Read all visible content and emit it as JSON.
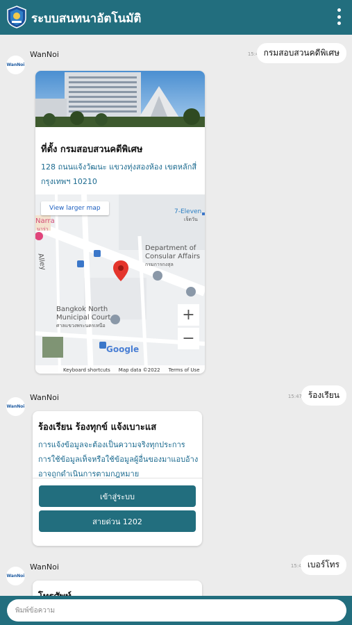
{
  "header": {
    "title": "ระบบสนทนาอัตโนมัติ"
  },
  "messages": [
    {
      "user_text": "กรมสอบสวนคดีพิเศษ",
      "time": "15:47"
    },
    {
      "user_text": "ร้องเรียน",
      "time": "15:47"
    },
    {
      "user_text": "เบอร์โทร",
      "time": "15:48"
    }
  ],
  "bot": {
    "name": "WanNoi",
    "avatar_text": "WanNoi"
  },
  "location_card": {
    "title": "ที่ตั้ง กรมสอบสวนคดีพิเศษ",
    "address": "128 ถนนแจ้งวัฒนะ แขวงทุ่งสองห้อง เขตหลักสี่ กรุงเทพฯ 10210",
    "map": {
      "view_larger": "View larger map",
      "labels": {
        "dept": "Department of",
        "dept2": "Consular Affairs",
        "dept_th": "กรมการกงสุล",
        "court": "Bangkok North",
        "court2": "Municipal Court",
        "court_th": "ศาลแขวงพระนครเหนือ",
        "seven": "7-Eleven",
        "seven_th": "เจ็ดวัน",
        "narra": "Narra",
        "narra_th": "นาร่า",
        "alley": "Alley"
      },
      "zoom_in": "+",
      "zoom_out": "−",
      "google": "Google",
      "shortcuts": "Keyboard shortcuts",
      "map_data": "Map data ©2022",
      "terms": "Terms of Use"
    }
  },
  "complaint_card": {
    "title": "ร้องเรียน ร้องทุกข์ แจ้งเบาะแส",
    "text": "การแจ้งข้อมูลจะต้องเป็นความจริงทุกประการ การใช้ข้อมูลเท็จหรือใช้ข้อมูลผู้อื่นของมาแอบอ้าง อาจถูกดำเนินการตามกฎหมาย",
    "button1": "เข้าสู่ระบบ",
    "button2": "สายด่วน 1202"
  },
  "phone_card": {
    "title": "โทรศัพท์"
  },
  "input": {
    "placeholder": "พิมพ์ข้อความ"
  },
  "colors": {
    "primary": "#226e7e",
    "background": "#ececec",
    "link": "#1b6a8f"
  }
}
